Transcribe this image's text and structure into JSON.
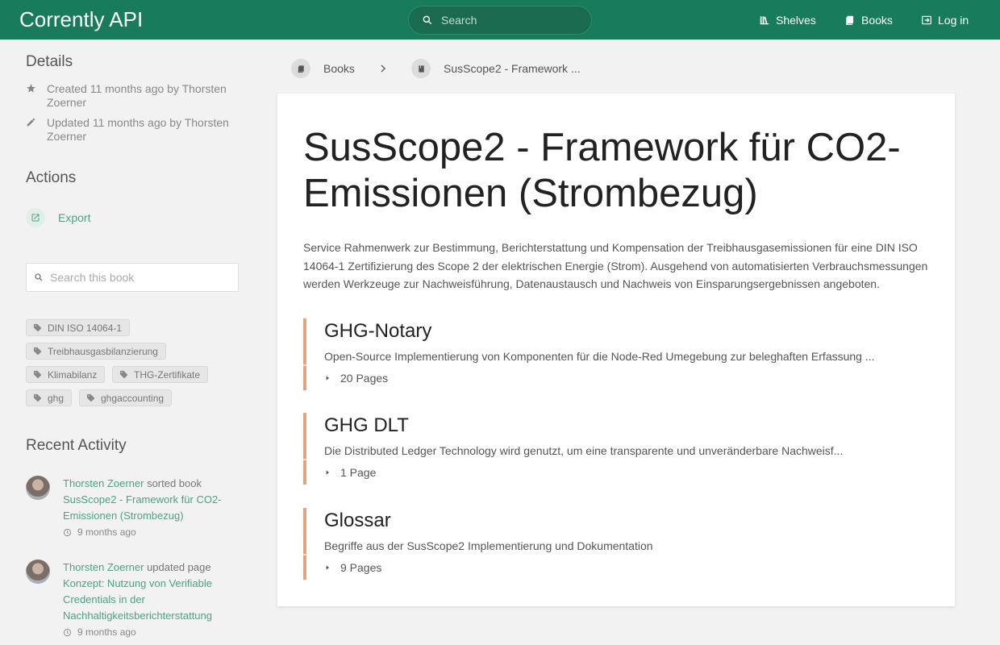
{
  "header": {
    "app_title": "Corrently API",
    "search_placeholder": "Search",
    "nav": {
      "shelves": "Shelves",
      "books": "Books",
      "login": "Log in"
    }
  },
  "sidebar": {
    "details_heading": "Details",
    "created": "Created 11 months ago by Thorsten Zoerner",
    "updated": "Updated 11 months ago by Thorsten Zoerner",
    "actions_heading": "Actions",
    "export_label": "Export",
    "book_search_placeholder": "Search this book",
    "tags": [
      "DIN ISO 14064-1",
      "Treibhausgasbilanzierung",
      "Klimabilanz",
      "THG-Zertifikate",
      "ghg",
      "ghgaccounting"
    ],
    "recent_heading": "Recent Activity",
    "activity": [
      {
        "user": "Thorsten Zoerner",
        "action": "sorted book",
        "target": "SusScope2 - Framework für CO2-Emissionen (Strombezug)",
        "time": "9 months ago"
      },
      {
        "user": "Thorsten Zoerner",
        "action": "updated page",
        "target": "Konzept: Nutzung von Verifiable Credentials in der Nachhaltigkeitsberichterstattung",
        "time": "9 months ago"
      }
    ]
  },
  "breadcrumb": {
    "books": "Books",
    "current": "SusScope2 - Framework ..."
  },
  "book": {
    "title": "SusScope2 - Framework für CO2-Emissionen (Strombezug)",
    "description": "Service Rahmenwerk zur Bestimmung, Berichterstattung und Kompensation der Treibhausgasemissionen für eine DIN ISO 14064-1 Zertifizierung des Scope 2 der elektrischen Energie (Strom). Ausgehend von automatisierten Verbrauchsmessungen werden Werkzeuge zur Nachweisführung, Datenaustausch und Nachweis von Einsparungsergebnissen angeboten.",
    "chapters": [
      {
        "title": "GHG-Notary",
        "description": "Open-Source Implementierung von Komponenten für die Node-Red Umegebung zur beleghaften Erfassung ...",
        "pages": "20 Pages"
      },
      {
        "title": "GHG DLT",
        "description": "Die Distributed Ledger Technology wird genutzt, um eine transparente und unveränderbare Nachweisf...",
        "pages": "1 Page"
      },
      {
        "title": "Glossar",
        "description": "Begriffe aus der SusScope2 Implementierung und Dokumentation",
        "pages": "9 Pages"
      }
    ]
  },
  "colors": {
    "header_bg": "#187b5b",
    "link": "#4aa386",
    "chapter_accent": "#e0a47f"
  }
}
